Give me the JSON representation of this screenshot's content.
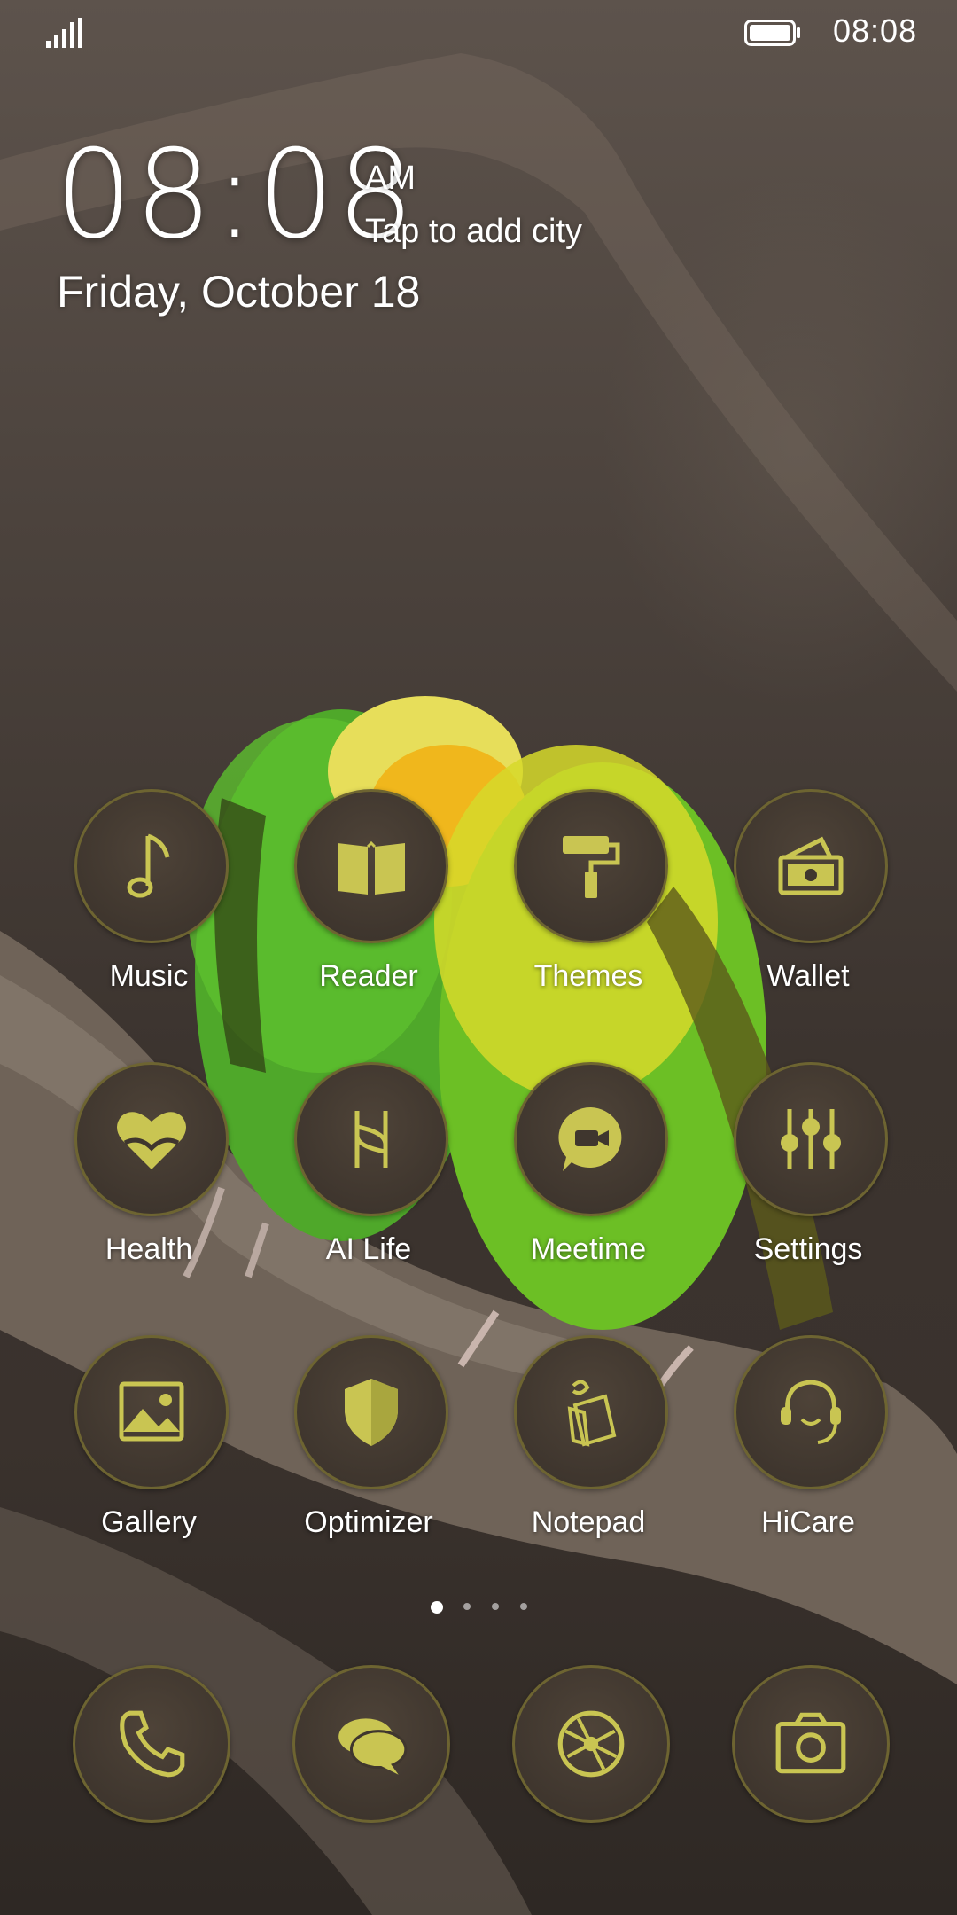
{
  "status_bar": {
    "time": "08:08",
    "signal_icon": "signal-icon",
    "battery_icon": "battery-icon"
  },
  "clock": {
    "time": "08:08",
    "ampm": "AM",
    "city_prompt": "Tap to add city",
    "date": "Friday, October 18"
  },
  "apps": [
    {
      "label": "Music",
      "icon": "music-note-icon"
    },
    {
      "label": "Reader",
      "icon": "book-icon"
    },
    {
      "label": "Themes",
      "icon": "paint-roller-icon"
    },
    {
      "label": "Wallet",
      "icon": "wallet-icon"
    },
    {
      "label": "Health",
      "icon": "heart-icon"
    },
    {
      "label": "AI Life",
      "icon": "ai-life-icon"
    },
    {
      "label": "Meetime",
      "icon": "video-chat-icon"
    },
    {
      "label": "Settings",
      "icon": "sliders-icon"
    },
    {
      "label": "Gallery",
      "icon": "image-icon"
    },
    {
      "label": "Optimizer",
      "icon": "shield-icon"
    },
    {
      "label": "Notepad",
      "icon": "notepad-icon"
    },
    {
      "label": "HiCare",
      "icon": "support-agent-icon"
    }
  ],
  "page_indicator": {
    "current": 1,
    "total": 4
  },
  "dock": [
    {
      "icon": "phone-icon"
    },
    {
      "icon": "messages-icon"
    },
    {
      "icon": "browser-icon"
    },
    {
      "icon": "camera-icon"
    }
  ],
  "colors": {
    "icon_accent": "#c9c552",
    "icon_ring": "#6d6431",
    "icon_bg": "#3f362e"
  }
}
